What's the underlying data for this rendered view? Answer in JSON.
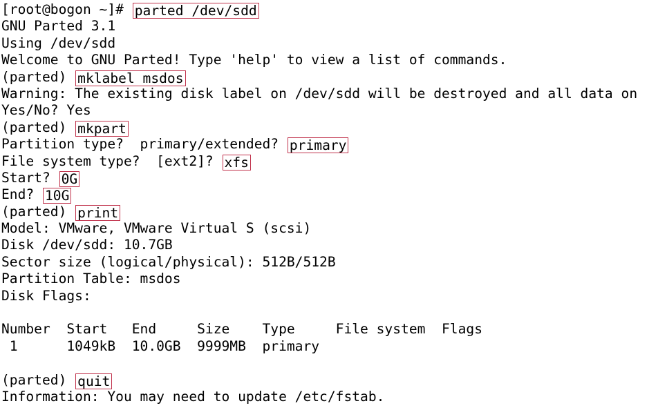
{
  "terminal": {
    "background_color": "#ffffff",
    "text_color": "#000000",
    "highlight_border_color": "#c0304a",
    "lines": [
      {
        "prefix": "[root@bogon ~]# ",
        "highlight": "parted /dev/sdd",
        "suffix": ""
      },
      {
        "prefix": "GNU Parted 3.1",
        "highlight": "",
        "suffix": ""
      },
      {
        "prefix": "Using /dev/sdd",
        "highlight": "",
        "suffix": ""
      },
      {
        "prefix": "Welcome to GNU Parted! Type 'help' to view a list of commands.",
        "highlight": "",
        "suffix": ""
      },
      {
        "prefix": "(parted) ",
        "highlight": "mklabel msdos",
        "suffix": ""
      },
      {
        "prefix": "Warning: The existing disk label on /dev/sdd will be destroyed and all data on",
        "highlight": "",
        "suffix": ""
      },
      {
        "prefix": "Yes/No? Yes",
        "highlight": "",
        "suffix": ""
      },
      {
        "prefix": "(parted) ",
        "highlight": "mkpart",
        "suffix": ""
      },
      {
        "prefix": "Partition type?  primary/extended? ",
        "highlight": "primary",
        "suffix": ""
      },
      {
        "prefix": "File system type?  [ext2]? ",
        "highlight": "xfs",
        "suffix": ""
      },
      {
        "prefix": "Start? ",
        "highlight": "0G",
        "suffix": ""
      },
      {
        "prefix": "End? ",
        "highlight": "10G",
        "suffix": ""
      },
      {
        "prefix": "(parted) ",
        "highlight": "print",
        "suffix": ""
      },
      {
        "prefix": "Model: VMware, VMware Virtual S (scsi)",
        "highlight": "",
        "suffix": ""
      },
      {
        "prefix": "Disk /dev/sdd: 10.7GB",
        "highlight": "",
        "suffix": ""
      },
      {
        "prefix": "Sector size (logical/physical): 512B/512B",
        "highlight": "",
        "suffix": ""
      },
      {
        "prefix": "Partition Table: msdos",
        "highlight": "",
        "suffix": ""
      },
      {
        "prefix": "Disk Flags:",
        "highlight": "",
        "suffix": ""
      },
      {
        "prefix": "",
        "highlight": "",
        "suffix": ""
      },
      {
        "prefix": "Number  Start   End     Size    Type     File system  Flags",
        "highlight": "",
        "suffix": ""
      },
      {
        "prefix": " 1      1049kB  10.0GB  9999MB  primary",
        "highlight": "",
        "suffix": ""
      },
      {
        "prefix": "",
        "highlight": "",
        "suffix": ""
      },
      {
        "prefix": "(parted) ",
        "highlight": "quit",
        "suffix": ""
      },
      {
        "prefix": "Information: You may need to update /etc/fstab.",
        "highlight": "",
        "suffix": ""
      }
    ],
    "prompt_user_host": "[root@bogon ~]#",
    "parted_prompt": "(parted)",
    "program_version": "GNU Parted 3.1",
    "device": "/dev/sdd",
    "commands_entered": [
      "parted /dev/sdd",
      "mklabel msdos",
      "mkpart",
      "primary",
      "xfs",
      "0G",
      "10G",
      "print",
      "quit"
    ],
    "disk_info": {
      "model": "VMware, VMware Virtual S (scsi)",
      "disk": "/dev/sdd: 10.7GB",
      "sector_size": "512B/512B",
      "partition_table": "msdos",
      "disk_flags": ""
    },
    "partition_table": {
      "headers": [
        "Number",
        "Start",
        "End",
        "Size",
        "Type",
        "File system",
        "Flags"
      ],
      "rows": [
        [
          "1",
          "1049kB",
          "10.0GB",
          "9999MB",
          "primary",
          "",
          ""
        ]
      ]
    },
    "final_message": "Information: You may need to update /etc/fstab."
  }
}
